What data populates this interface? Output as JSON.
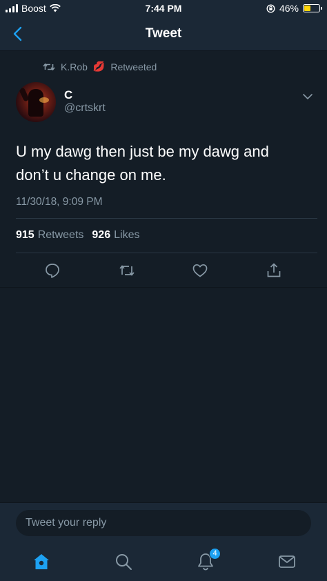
{
  "status_bar": {
    "carrier": "Boost",
    "time": "7:44 PM",
    "battery_percent": "46%",
    "battery_level": 0.46,
    "icons": [
      "signal-icon",
      "wifi-icon",
      "orientation-lock-icon",
      "battery-icon"
    ]
  },
  "nav": {
    "title": "Tweet",
    "back_icon": "chevron-left-icon"
  },
  "retweet": {
    "user": "K.Rob",
    "emoji": "💋",
    "label": "Retweeted"
  },
  "tweet": {
    "name": "C",
    "handle": "@crtskrt",
    "text": "U my dawg then just be my dawg and don’t u change on me.",
    "timestamp": "11/30/18, 9:09 PM",
    "retweets_count": "915",
    "retweets_label": "Retweets",
    "likes_count": "926",
    "likes_label": "Likes"
  },
  "actions": [
    "reply-icon",
    "retweet-icon",
    "like-icon",
    "share-icon"
  ],
  "reply": {
    "placeholder": "Tweet your reply"
  },
  "tabbar": {
    "notifications_badge": "4",
    "tabs": [
      "home-icon",
      "search-icon",
      "notifications-icon",
      "messages-icon"
    ]
  },
  "colors": {
    "background": "#141d26",
    "bar": "#1b2836",
    "accent": "#1da1f2",
    "muted": "#8899a6",
    "battery": "#ffd60a"
  }
}
